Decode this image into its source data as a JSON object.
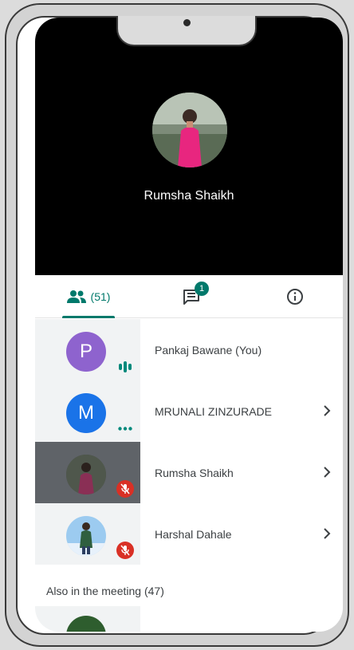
{
  "hero": {
    "name": "Rumsha Shaikh"
  },
  "tabs": {
    "people": {
      "count": "(51)"
    },
    "chat": {
      "badge": "1"
    }
  },
  "participants": [
    {
      "name": "Pankaj Bawane (You)",
      "initial": "P",
      "color": "#8e63ce",
      "status": "speaking"
    },
    {
      "name": "MRUNALI ZINZURADE",
      "initial": "M",
      "color": "#1a73e8",
      "status": "connecting"
    },
    {
      "name": "Rumsha Shaikh",
      "initial": "",
      "color": "#5f6368",
      "status": "muted"
    },
    {
      "name": "Harshal Dahale",
      "initial": "",
      "color": "#8ab4f8",
      "status": "muted"
    }
  ],
  "also_in_meeting": {
    "label": "Also in the meeting (47)"
  },
  "colors": {
    "accent": "#00796b",
    "muted": "#d93025"
  }
}
